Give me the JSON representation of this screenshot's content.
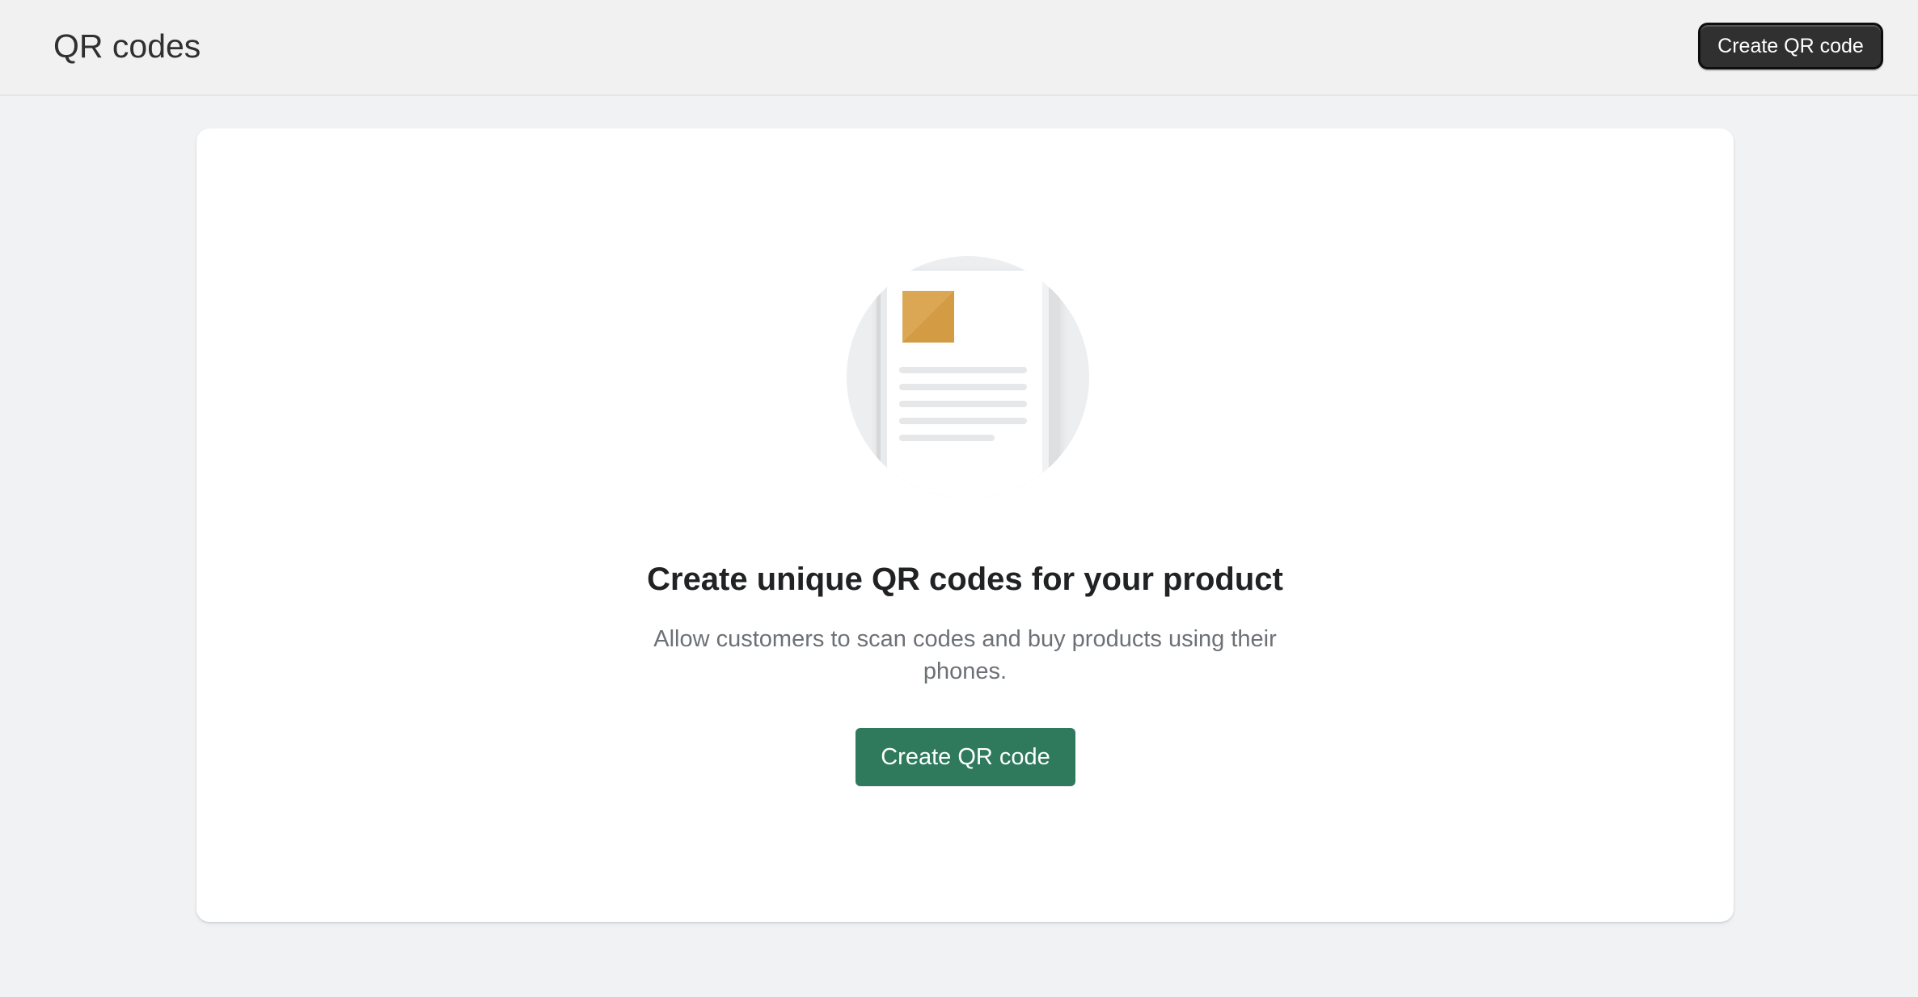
{
  "header": {
    "title": "QR codes",
    "create_button_label": "Create QR code"
  },
  "empty_state": {
    "illustration_icon": "document-with-image-icon",
    "heading": "Create unique QR codes for your product",
    "description": "Allow customers to scan codes and buy products using their phones.",
    "action_label": "Create QR code"
  },
  "colors": {
    "primary_button": "#2f7a5c",
    "top_button": "#303030",
    "page_background": "#f1f2f4",
    "illustration_accent": "#d9a24c"
  }
}
